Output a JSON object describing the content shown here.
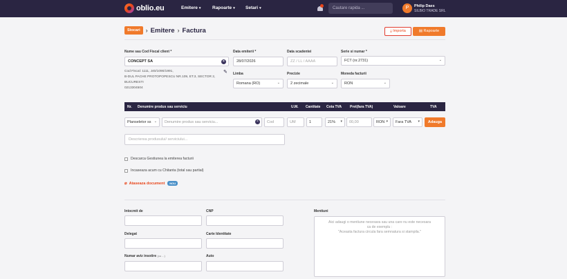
{
  "nav": {
    "logo": "oblio.eu",
    "menu": [
      "Emitere",
      "Rapoarte",
      "Setari"
    ],
    "search_placeholder": "Cautare rapida ...",
    "user_initial": "P",
    "user_name": "Philip Daes",
    "user_company": "SILBIO TRADE SRL"
  },
  "header": {
    "badge": "Stocari",
    "crumb1": "Emitere",
    "crumb2": "Factura",
    "import_label": "Importa",
    "reports_label": "Rapoarte"
  },
  "form": {
    "client_label": "Nume sau Cod Fiscal client *",
    "client_value": "CONCEPT SA",
    "client_info": [
      "Cod Fiscal: 1111, J40/1090/1991,",
      "B-DUL PACHE PROTOPOPESCU NR.109, ET.3, SECTOR 2,",
      "BUCURESTI",
      "0213304504"
    ],
    "issue_date_label": "Data emiterii *",
    "issue_date_value": "28/07/2026",
    "due_date_label": "Data scadentei",
    "due_date_placeholder": "ZZ / LL / AAAA",
    "series_label": "Serie si numar *",
    "series_value": "FCT (nr.2731)",
    "language_label": "Limba",
    "language_value": "Romana (RO)",
    "precision_label": "Precizie",
    "precision_value": "2 zecimale",
    "currency_label": "Moneda facturii",
    "currency_value": "RON"
  },
  "table": {
    "headers": [
      "Nr.",
      "Denumire produs sau serviciu",
      "U.M.",
      "Cantitate",
      "Cota TVA",
      "Pret(fara TVA)",
      "Valoare",
      "TVA"
    ],
    "row": {
      "type": "Planseletor ss",
      "name_placeholder": "Denumire produs sau serviciu...",
      "code_placeholder": "Cod",
      "um_placeholder": "UM",
      "qty": "1",
      "vat": "21%",
      "price": "00,00",
      "currency": "RON",
      "vat_type": "Fara TVA",
      "add_label": "Adauga"
    },
    "desc_placeholder": "Descrierea produsului/ serviciului..."
  },
  "options": {
    "check1": "Descarca Gestiunea la emiterea facturii",
    "check2": "Incaseaza acum cu Chitanta (total sau partial)",
    "attach": "Ataseaza document",
    "attach_badge": "NOU"
  },
  "bottom": {
    "prepared_by": "Intocmit de",
    "cnp": "CNP",
    "delegate": "Delegat",
    "id_card": "Carte Identitate",
    "shipping_notice": "Numar aviz insotire",
    "shipping_notice_small": "(cu ...)",
    "auto": "Auto",
    "notes_label": "Mentiuni",
    "notes_placeholder_1": "Aici adaugi o mentiune necesara sau una care nu este necesara",
    "notes_placeholder_2": "ca de exemplu :",
    "notes_placeholder_3": "\"Aceasta factura circula fara semnatura si stampila.\""
  }
}
